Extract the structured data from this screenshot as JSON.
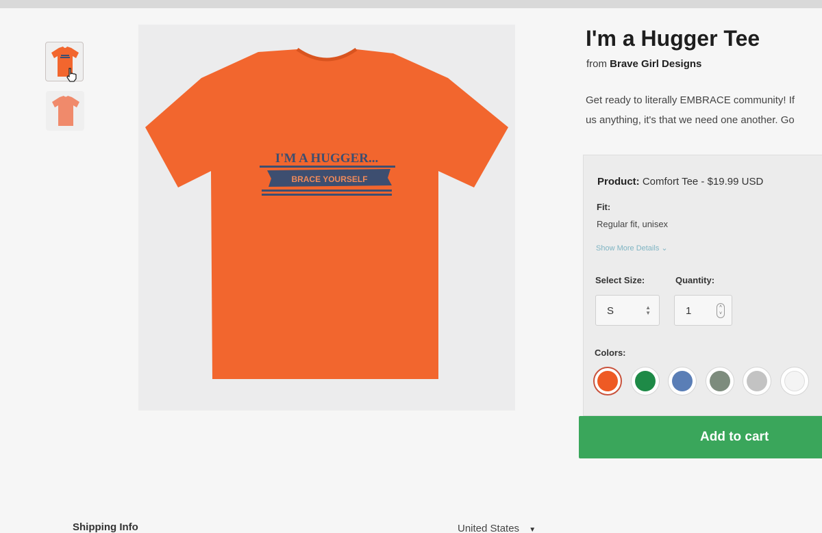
{
  "product": {
    "title": "I'm a Hugger Tee",
    "by_prefix": "from",
    "brand": "Brave Girl Designs",
    "description_line1": "Get ready to literally EMBRACE community! If",
    "description_line2": "us anything, it's that we need one another. Go",
    "shirt_print_line1": "I'M A HUGGER...",
    "shirt_print_line2": "BRACE YOURSELF"
  },
  "options": {
    "product_label": "Product:",
    "product_value": "Comfort Tee - $19.99 USD",
    "fit_label": "Fit:",
    "fit_value": "Regular fit, unisex",
    "more_details": "Show More Details",
    "size_label": "Select Size:",
    "size_value": "S",
    "quantity_label": "Quantity:",
    "quantity_value": "1",
    "colors_label": "Colors:",
    "colors": [
      {
        "name": "orange",
        "hex": "#ee5a24",
        "selected": true
      },
      {
        "name": "green",
        "hex": "#1e8a47",
        "selected": false
      },
      {
        "name": "blue",
        "hex": "#5a7eb6",
        "selected": false
      },
      {
        "name": "sage",
        "hex": "#7d8c7d",
        "selected": false
      },
      {
        "name": "light-gray",
        "hex": "#c3c3c3",
        "selected": false
      },
      {
        "name": "white",
        "hex": "#f4f4f4",
        "selected": false
      }
    ]
  },
  "cart": {
    "label": "Add to cart"
  },
  "footer": {
    "shipping_label": "Shipping Info",
    "country": "United States"
  },
  "theme": {
    "shirt_color": "#f2662e",
    "print_color": "#3d4e70",
    "cart_color": "#3aa65b"
  }
}
